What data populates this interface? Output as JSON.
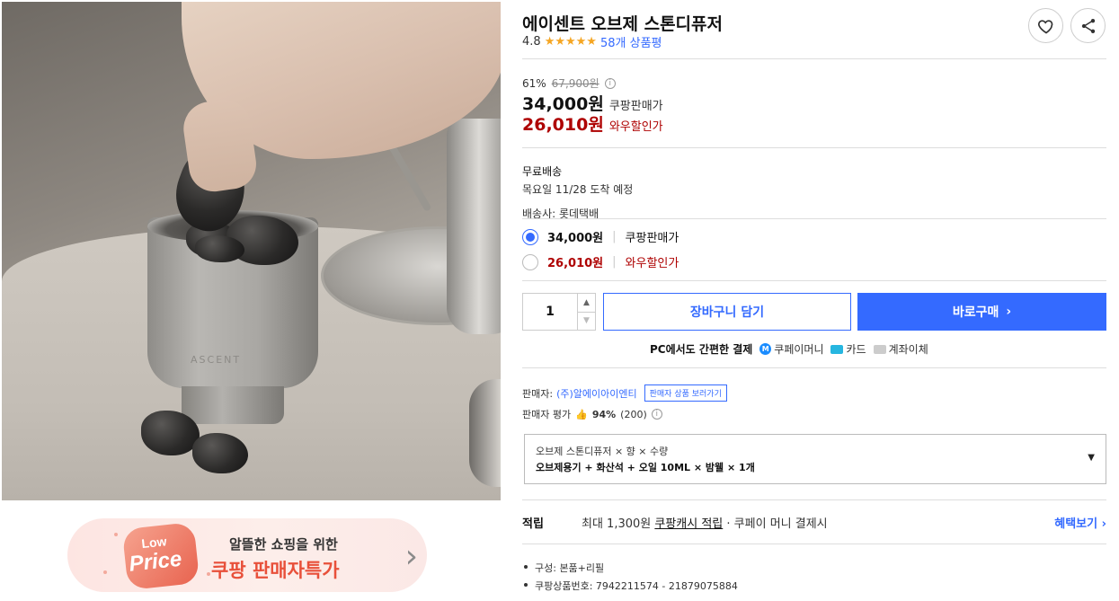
{
  "banner": {
    "badge_low": "Low",
    "badge_price": "Price",
    "line1": "알뜰한 쇼핑을 위한",
    "line2": "쿠팡 판매자특가"
  },
  "product": {
    "title": "에이센트 오브제 스톤디퓨저",
    "rating": "4.8",
    "stars": "★★★★★",
    "review_count": "58개 상품평",
    "pot_logo": "ASCENT"
  },
  "price": {
    "discount_rate": "61%",
    "original": "67,900원",
    "sale": "34,000원",
    "sale_label": "쿠팡판매가",
    "wow": "26,010원",
    "wow_label": "와우할인가"
  },
  "shipping": {
    "type": "무료배송",
    "eta": "목요일 11/28 도착 예정",
    "carrier": "배송사: 롯데택배"
  },
  "options": [
    {
      "price": "34,000원",
      "label": "쿠팡판매가",
      "selected": true
    },
    {
      "price": "26,010원",
      "label": "와우할인가",
      "selected": false
    }
  ],
  "purchase": {
    "quantity": "1",
    "cart_label": "장바구니 담기",
    "buy_label": "바로구매",
    "buy_arrow": "›"
  },
  "payment": {
    "lead": "PC에서도 간편한 결제",
    "coupay": "쿠페이머니",
    "card": "카드",
    "bank": "계좌이체"
  },
  "seller": {
    "label": "판매자:",
    "name": "(주)알에이아이엔티",
    "link": "판매자 상품 보러가기",
    "rating_label": "판매자 평가",
    "rating_pct": "94%",
    "rating_count": "(200)"
  },
  "option_select": {
    "title": "오브제 스톤디퓨저 × 향 × 수량",
    "value": "오브제용기 + 화산석 + 오일 10ML × 밤웰 × 1개"
  },
  "points": {
    "label": "적립",
    "desc_prefix": "최대 1,300원",
    "desc_link": "쿠팡캐시 적립",
    "desc_suffix": "· 쿠페이 머니 결제시",
    "more": "혜택보기 ›"
  },
  "specs": [
    "구성: 본품+리필",
    "쿠팡상품번호: 7942211574 - 21879075884"
  ],
  "colors": {
    "accent": "#346aff",
    "wow_red": "#ae0000",
    "star": "#f5a623"
  }
}
